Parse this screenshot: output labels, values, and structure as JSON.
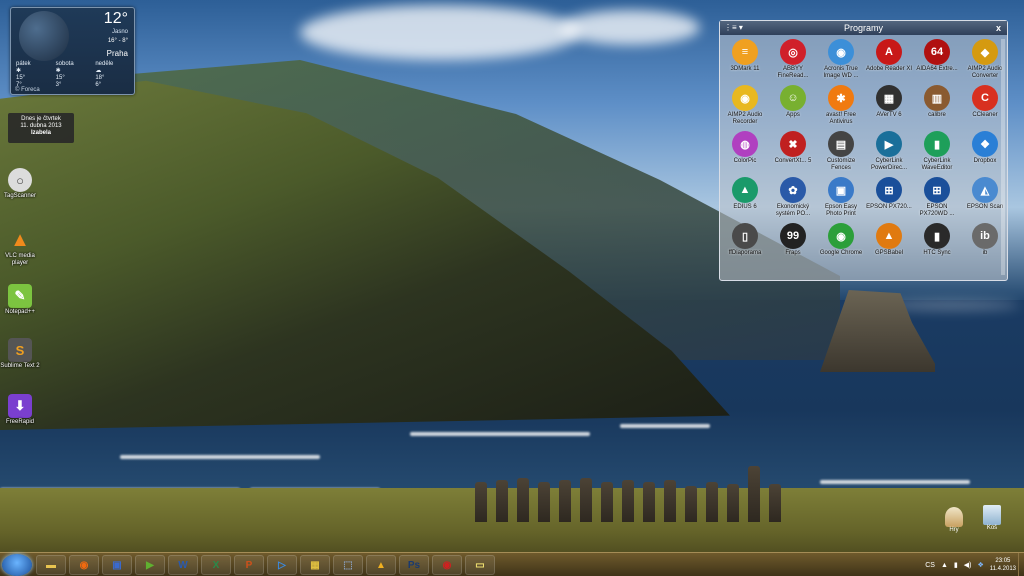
{
  "weather": {
    "temperature": "12°",
    "condition": "Jasno",
    "range": "16° - 8°",
    "city": "Praha",
    "forecast": [
      {
        "day": "pátek",
        "high": "15°",
        "low": "7°"
      },
      {
        "day": "sobota",
        "high": "15°",
        "low": "3°"
      },
      {
        "day": "neděle",
        "high": "18°",
        "low": "6°"
      }
    ],
    "source": "© Foreca"
  },
  "date_tip": {
    "line1": "Dnes je čtvrtek",
    "line2": "11. dubna 2013",
    "name": "Izabela"
  },
  "desktop_icons": [
    {
      "label": "TagScanner",
      "glyph": "○",
      "color": "#e8e8e8"
    },
    {
      "label": "VLC media player",
      "glyph": "▲",
      "color": "#f08a1c"
    },
    {
      "label": "Notepad++",
      "glyph": "✎",
      "color": "#7cc440"
    },
    {
      "label": "Sublime Text 2",
      "glyph": "S",
      "color": "#555555"
    },
    {
      "label": "FreeRapid",
      "glyph": "⬇",
      "color": "#7a3fcf"
    }
  ],
  "fence": {
    "title": "Programy",
    "close": "x",
    "menu": "⋮≡ ▾",
    "items": [
      {
        "label": "3DMark 11",
        "glyph": "≡",
        "color": "#f0a020"
      },
      {
        "label": "ABBYY FineRead...",
        "glyph": "◎",
        "color": "#d0202a"
      },
      {
        "label": "Acronis True Image WD ...",
        "glyph": "◉",
        "color": "#3c8fd8"
      },
      {
        "label": "Adobe Reader XI",
        "glyph": "A",
        "color": "#c81818"
      },
      {
        "label": "AIDA64 Extre...",
        "glyph": "64",
        "color": "#b01010"
      },
      {
        "label": "AIMP2 Audio Converter",
        "glyph": "◆",
        "color": "#d59a10"
      },
      {
        "label": "AIMP2 Audio Recorder",
        "glyph": "◉",
        "color": "#e8b820"
      },
      {
        "label": "Apps",
        "glyph": "☺",
        "color": "#78b030"
      },
      {
        "label": "avast! Free Antivirus",
        "glyph": "✱",
        "color": "#f07a10"
      },
      {
        "label": "AVerTV 6",
        "glyph": "▦",
        "color": "#303030"
      },
      {
        "label": "calibre",
        "glyph": "▥",
        "color": "#8a5a30"
      },
      {
        "label": "CCleaner",
        "glyph": "C",
        "color": "#d83020"
      },
      {
        "label": "ColorPic",
        "glyph": "◍",
        "color": "#b040c0"
      },
      {
        "label": "ConvertXt... 5",
        "glyph": "✖",
        "color": "#c02020"
      },
      {
        "label": "Customize Fences",
        "glyph": "▤",
        "color": "#444444"
      },
      {
        "label": "CyberLink PowerDirec...",
        "glyph": "▶",
        "color": "#1a6f9a"
      },
      {
        "label": "CyberLink WaveEditor",
        "glyph": "▮",
        "color": "#1e9f5a"
      },
      {
        "label": "Dropbox",
        "glyph": "❖",
        "color": "#2a7fd6"
      },
      {
        "label": "EDIUS 6",
        "glyph": "▲",
        "color": "#1a9a6a"
      },
      {
        "label": "Ekonomický systém PO...",
        "glyph": "✿",
        "color": "#2a5aa8"
      },
      {
        "label": "Epson Easy Photo Print",
        "glyph": "▣",
        "color": "#3a7ac8"
      },
      {
        "label": "EPSON PX720...",
        "glyph": "⊞",
        "color": "#1a4f9a"
      },
      {
        "label": "EPSON PX720WD ...",
        "glyph": "⊞",
        "color": "#1a4f9a"
      },
      {
        "label": "EPSON Scan",
        "glyph": "◭",
        "color": "#4a8ad0"
      },
      {
        "label": "ffDiaporama",
        "glyph": "▯",
        "color": "#4a4a4a"
      },
      {
        "label": "Fraps",
        "glyph": "99",
        "color": "#222222"
      },
      {
        "label": "Google Chrome",
        "glyph": "◉",
        "color": "#2c9f3a"
      },
      {
        "label": "GPSBabel",
        "glyph": "▲",
        "color": "#e07a10"
      },
      {
        "label": "HTC Sync",
        "glyph": "▮",
        "color": "#2a2a2a"
      },
      {
        "label": "ib",
        "glyph": "ib",
        "color": "#6a6a6a"
      }
    ]
  },
  "taskbar": {
    "apps": [
      {
        "name": "folder",
        "glyph": "▬",
        "color": "#e8c450"
      },
      {
        "name": "firefox",
        "glyph": "◉",
        "color": "#f06a10"
      },
      {
        "name": "save",
        "glyph": "▣",
        "color": "#3a6ad0"
      },
      {
        "name": "media",
        "glyph": "▶",
        "color": "#60b030"
      },
      {
        "name": "word",
        "glyph": "W",
        "color": "#2a5ab0"
      },
      {
        "name": "excel",
        "glyph": "X",
        "color": "#2a8a4a"
      },
      {
        "name": "powerpoint",
        "glyph": "P",
        "color": "#d0501a"
      },
      {
        "name": "player",
        "glyph": "▷",
        "color": "#3a8ae0"
      },
      {
        "name": "windows",
        "glyph": "▦",
        "color": "#e0c040"
      },
      {
        "name": "installer",
        "glyph": "⬚",
        "color": "#8aa0c0"
      },
      {
        "name": "aimp",
        "glyph": "▲",
        "color": "#f0b020"
      },
      {
        "name": "photoshop",
        "glyph": "Ps",
        "color": "#1a3a70"
      },
      {
        "name": "record",
        "glyph": "◉",
        "color": "#d02020"
      },
      {
        "name": "notes",
        "glyph": "▭",
        "color": "#f0e070"
      }
    ],
    "lang": "CS",
    "time": "23:05",
    "date": "11.4.2013"
  },
  "desktop_right": [
    {
      "label": "Hry"
    },
    {
      "label": "Koš"
    }
  ]
}
